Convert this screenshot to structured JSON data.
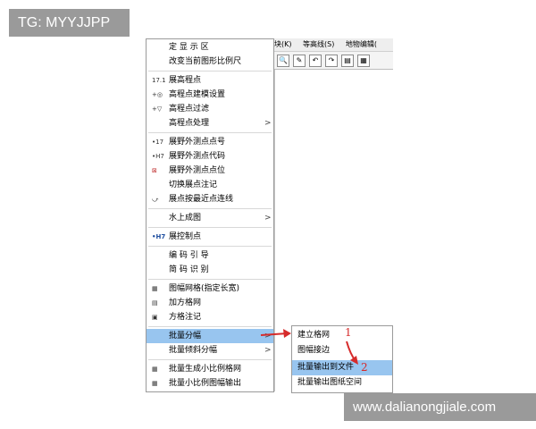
{
  "watermark_top": "TG: MYYJJPP",
  "watermark_bottom": "www.dalianongjiale.com",
  "app": {
    "menubar": [
      "块(K)",
      "等高线(S)",
      "地物编辑("
    ]
  },
  "menu": {
    "items": [
      {
        "label": "定 显 示 区",
        "icon": ""
      },
      {
        "label": "改变当前图形比例尺",
        "icon": ""
      },
      {
        "label": "展高程点",
        "icon": "17.1"
      },
      {
        "label": "高程点建模设置",
        "icon": "+◎"
      },
      {
        "label": "高程点过滤",
        "icon": "+▽"
      },
      {
        "label": "高程点处理",
        "icon": "",
        "arrow": ">"
      },
      {
        "label": "展野外测点点号",
        "icon": "•17"
      },
      {
        "label": "展野外测点代码",
        "icon": "•H7"
      },
      {
        "label": "展野外测点点位",
        "icon": "⊠"
      },
      {
        "label": "切换展点注记",
        "icon": ""
      },
      {
        "label": "展点按最近点连线",
        "icon": "⤻"
      },
      {
        "label": "水上成图",
        "icon": "",
        "arrow": ">"
      },
      {
        "label": "展控制点",
        "icon": "•H7"
      },
      {
        "label": "编 码 引 导",
        "icon": ""
      },
      {
        "label": "简 码 识 别",
        "icon": ""
      },
      {
        "label": "图幅网格(指定长宽)",
        "icon": "▦"
      },
      {
        "label": "加方格网",
        "icon": "▤"
      },
      {
        "label": "方格注记",
        "icon": "▣"
      },
      {
        "label": "批量分幅",
        "icon": "",
        "arrow": ">"
      },
      {
        "label": "批量倾斜分幅",
        "icon": "",
        "arrow": ">"
      },
      {
        "label": "批量生成小比例格网",
        "icon": "▦"
      },
      {
        "label": "批量小比例图幅输出",
        "icon": "▦"
      }
    ]
  },
  "submenu": {
    "items": [
      {
        "label": "建立格网"
      },
      {
        "label": "图幅接边"
      },
      {
        "label": "批量输出到文件"
      },
      {
        "label": "批量输出图纸空间"
      }
    ]
  },
  "annotations": {
    "step1": "1",
    "step2": "2"
  },
  "colors": {
    "highlight": "#98c5ef",
    "annotation": "#d62b2b"
  }
}
